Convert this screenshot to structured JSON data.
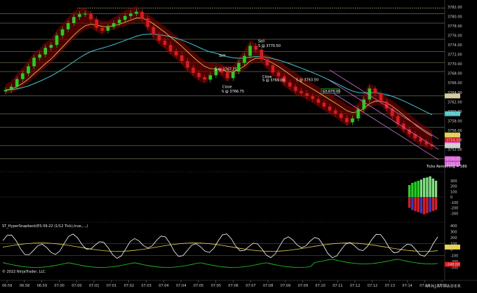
{
  "colors": {
    "background": "#000000",
    "bull_candle": "#1fd31f",
    "bear_candle": "#e0191c",
    "cloud": "#8b0000",
    "ema_fast": "#e8d24a",
    "ema_slow": "#3ec9cf",
    "level_line": "#d9d7a0",
    "dotted_high": "#c8c860",
    "regression": "#d36bd3"
  },
  "header": {
    "indicator_title": "ST_HyperSnapback(ES 09-22 (1/12 Tick),true,...,)",
    "copyright": "© 2022 NinjaTrader, LLC",
    "ticks_remaining": "Ticks Remaining = 589",
    "brand": "NINJATRADER"
  },
  "chart_data": [
    {
      "type": "candlestick",
      "instrument": "ES 09-22",
      "title": "",
      "ylim": [
        3748,
        3782
      ],
      "y_ticks": [
        3782.0,
        3780.0,
        3778.0,
        3776.0,
        3774.0,
        3772.0,
        3770.0,
        3768.0,
        3766.0,
        3764.0,
        3762.0,
        3760.0,
        3758.0,
        3756.0,
        3754.0,
        3752.0,
        3750.0
      ],
      "x_ticks": [
        "06:56",
        "06:58",
        "06:59",
        "07:00",
        "07:00",
        "07:01",
        "07:01",
        "07:02",
        "07:03",
        "07:04",
        "07:04",
        "07:05",
        "07:05",
        "07:06",
        "07:07",
        "07:08",
        "07:09",
        "07:09",
        "07:10",
        "07:11",
        "07:12",
        "07:12",
        "07:13",
        "07:14",
        "07:14",
        "07:15"
      ],
      "annotations": [
        {
          "text": "Sell",
          "price": 3771.5
        },
        {
          "text": "S @ 3767.75",
          "price": 3768.6
        },
        {
          "text": "Sell",
          "price": 3774.5
        },
        {
          "text": "S @ 3770.50",
          "price": 3773.6
        },
        {
          "text": "S @ 3763.50",
          "price": 3766.4
        },
        {
          "text": "Close",
          "price": 3764.9
        },
        {
          "text": "S @ 3766.75",
          "price": 3764.0
        },
        {
          "text": "Close",
          "price": 3767.1
        },
        {
          "text": "S @ 3769.00",
          "price": 3766.3
        }
      ],
      "price_labels": [
        {
          "text": "3763.25",
          "color": "#d7c99a",
          "price": 3763.25
        },
        {
          "text": "3759.50",
          "color": "#3ec9cf",
          "price": 3759.5
        },
        {
          "text": "3755.00",
          "color": "#e8d24a",
          "price": 3755.0
        },
        {
          "text": "3754.00",
          "color": "#e0191c",
          "price": 3754.0
        },
        {
          "text": "3753.00",
          "color": "#e060e0",
          "price": 3753.0
        },
        {
          "text": "3752.75",
          "color": "#cfcfcf",
          "price": 3752.75
        },
        {
          "text": "3750.01",
          "color": "#e060e0",
          "price": 3750.01
        },
        {
          "text": "3748.93",
          "color": "#e060e0",
          "price": 3748.93
        }
      ],
      "inline_label": "$3,675.00",
      "close": [
        3764.5,
        3765.2,
        3766.8,
        3768.0,
        3769.5,
        3771.3,
        3772.0,
        3773.4,
        3774.0,
        3776.0,
        3777.3,
        3778.6,
        3779.9,
        3780.5,
        3780.6,
        3779.4,
        3777.6,
        3777.0,
        3777.8,
        3778.6,
        3779.3,
        3780.1,
        3780.6,
        3781.0,
        3779.6,
        3777.8,
        3776.2,
        3774.9,
        3774.0,
        3772.7,
        3771.8,
        3770.6,
        3769.2,
        3768.1,
        3767.2,
        3766.7,
        3767.6,
        3769.0,
        3768.2,
        3767.0,
        3768.4,
        3770.2,
        3771.7,
        3773.8,
        3773.0,
        3771.0,
        3769.7,
        3768.2,
        3767.4,
        3766.1,
        3765.2,
        3764.3,
        3763.8,
        3763.2,
        3762.6,
        3761.8,
        3761.0,
        3760.2,
        3759.5,
        3758.6,
        3757.7,
        3758.5,
        3760.5,
        3762.5,
        3764.8,
        3763.8,
        3762.1,
        3760.6,
        3759.0,
        3757.4,
        3756.2,
        3755.2,
        3754.3,
        3753.6,
        3753.0,
        3752.6
      ]
    },
    {
      "type": "bar",
      "name": "histogram",
      "ylim": [
        -400,
        400
      ],
      "y_ticks": [
        300,
        200,
        100,
        0,
        -100,
        -200,
        -300
      ],
      "positive": [
        220,
        260,
        280,
        300,
        320,
        350,
        360,
        380,
        340,
        300
      ],
      "negative": [
        -200,
        -240,
        -260,
        -280,
        -300,
        -320,
        -300,
        -280,
        -260,
        -240
      ]
    },
    {
      "type": "line",
      "name": "oscillator",
      "ylim": [
        -400,
        400
      ],
      "y_ticks": [
        400,
        300,
        200,
        100,
        0,
        -100,
        -200,
        -300
      ],
      "price_labels": [
        {
          "text": "41.75",
          "color": "#e8d24a"
        },
        {
          "text": "-248.00",
          "color": "#e0191c"
        }
      ]
    }
  ]
}
